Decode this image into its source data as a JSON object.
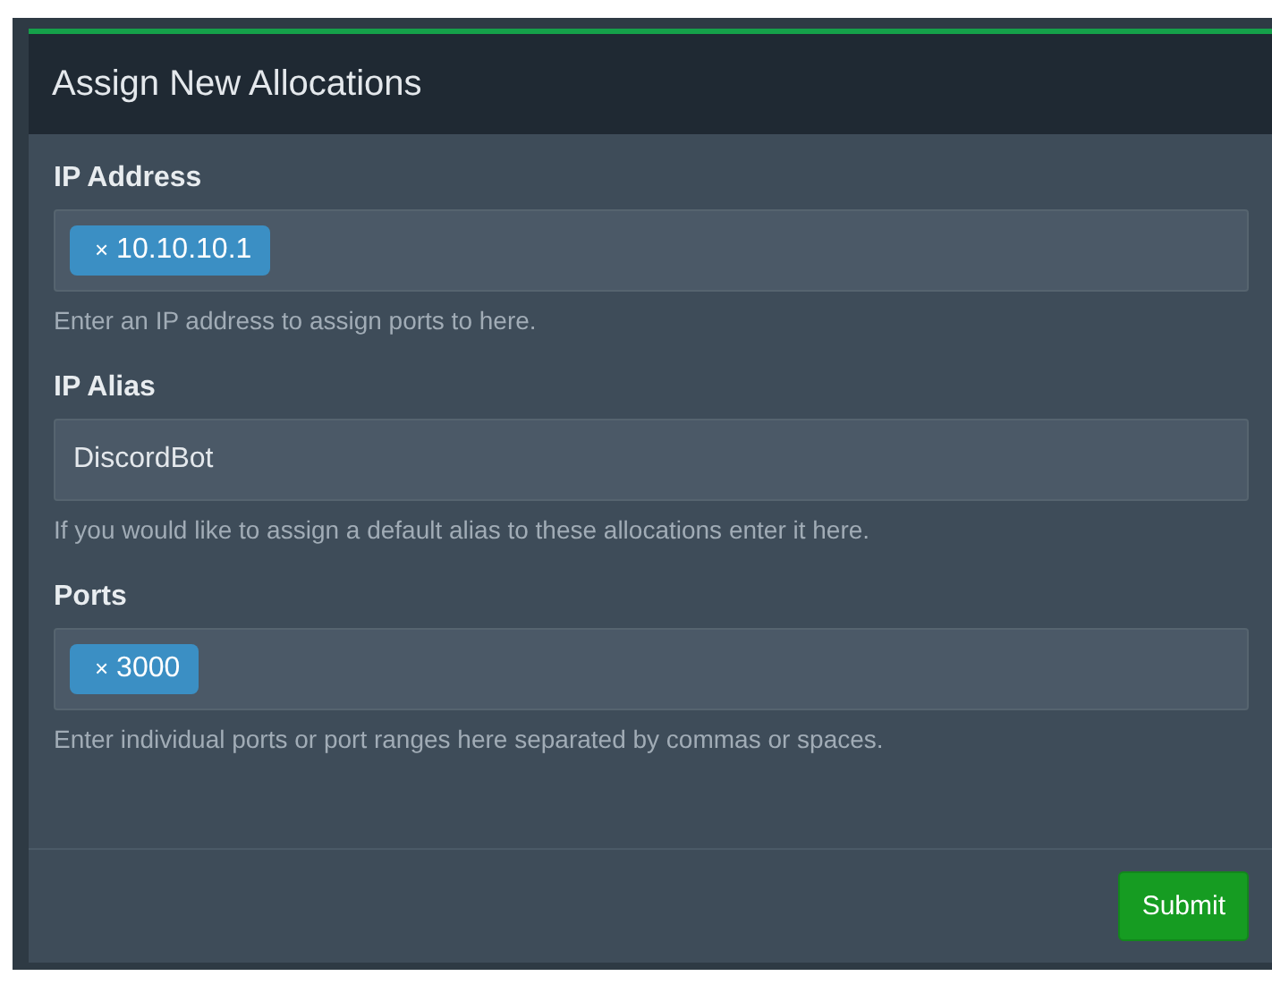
{
  "panel": {
    "title": "Assign New Allocations"
  },
  "fields": [
    {
      "label": "IP Address",
      "kind": "tags",
      "tags": [
        "10.10.10.1"
      ],
      "remove_glyph": "×",
      "help": "Enter an IP address to assign ports to here."
    },
    {
      "label": "IP Alias",
      "kind": "text",
      "value": "DiscordBot",
      "help": "If you would like to assign a default alias to these allocations enter it here."
    },
    {
      "label": "Ports",
      "kind": "tags",
      "tags": [
        "3000"
      ],
      "remove_glyph": "×",
      "help": "Enter individual ports or port ranges here separated by commas or spaces."
    }
  ],
  "submit": "Submit"
}
